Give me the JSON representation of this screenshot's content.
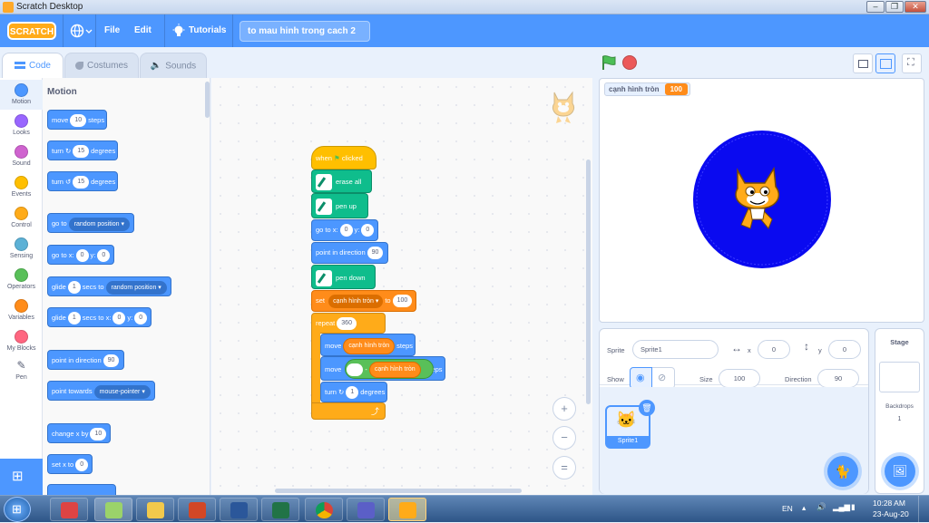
{
  "window": {
    "title": "Scratch Desktop"
  },
  "menubar": {
    "logo": "SCRATCH",
    "file": "File",
    "edit": "Edit",
    "tutorials": "Tutorials",
    "project_name": "to mau hinh trong cach 2"
  },
  "tabs": {
    "code": "Code",
    "costumes": "Costumes",
    "sounds": "Sounds"
  },
  "categories": [
    {
      "label": "Motion",
      "color": "#4c97ff"
    },
    {
      "label": "Looks",
      "color": "#9966ff"
    },
    {
      "label": "Sound",
      "color": "#cf63cf"
    },
    {
      "label": "Events",
      "color": "#ffbf00"
    },
    {
      "label": "Control",
      "color": "#ffab19"
    },
    {
      "label": "Sensing",
      "color": "#5cb1d6"
    },
    {
      "label": "Operators",
      "color": "#59c059"
    },
    {
      "label": "Variables",
      "color": "#ff8c1a"
    },
    {
      "label": "My Blocks",
      "color": "#ff6680"
    },
    {
      "label": "Pen",
      "color": "#0fbd8c"
    }
  ],
  "palette": {
    "heading": "Motion",
    "move": "move",
    "move_val": "10",
    "steps": "steps",
    "turn": "turn",
    "turn_r_val": "15",
    "degrees": "degrees",
    "turn_l_val": "15",
    "goto": "go to",
    "goto_menu": "random position",
    "gotoxy": "go to x:",
    "gotoxy_x": "0",
    "y": "y:",
    "gotoxy_y": "0",
    "glide": "glide",
    "glide_secs": "1",
    "secs_to": "secs to",
    "glide_menu": "random position",
    "glide2_secs": "1",
    "secs_to_x": "secs to x:",
    "glide2_x": "0",
    "glide2_y": "0",
    "point_dir": "point in direction",
    "point_dir_val": "90",
    "point_towards": "point towards",
    "point_towards_menu": "mouse-pointer",
    "change_x": "change x by",
    "change_x_val": "10",
    "set_x": "set x to",
    "set_x_val": "0"
  },
  "script": {
    "when": "when",
    "clicked": "clicked",
    "erase_all": "erase all",
    "pen_up": "pen up",
    "goto_x": "go to x:",
    "goto_x_val": "0",
    "y": "y:",
    "goto_y_val": "0",
    "point_dir": "point in direction",
    "point_dir_val": "90",
    "pen_down": "pen down",
    "set": "set",
    "var": "cạnh hình tròn",
    "to": "to",
    "set_val": "100",
    "repeat": "repeat",
    "repeat_val": "360",
    "move": "move",
    "steps": "steps",
    "minus": "-",
    "turn": "turn",
    "turn_val": "1",
    "degrees": "degrees"
  },
  "zoom": {
    "in": "+",
    "out": "−",
    "reset": "="
  },
  "stage": {
    "monitor_label": "cạnh hình tròn",
    "monitor_value": "100",
    "circle_color": "#0a0af0"
  },
  "sprite_info": {
    "sprite_label": "Sprite",
    "sprite_name": "Sprite1",
    "x_label": "x",
    "x_val": "0",
    "y_label": "y",
    "y_val": "0",
    "show_label": "Show",
    "size_label": "Size",
    "size_val": "100",
    "direction_label": "Direction",
    "direction_val": "90",
    "thumb_name": "Sprite1"
  },
  "stage_pane": {
    "title": "Stage",
    "backdrops_label": "Backdrops",
    "backdrops_count": "1"
  },
  "taskbar": {
    "lang": "EN",
    "time": "10:28 AM",
    "date": "23-Aug-20"
  }
}
